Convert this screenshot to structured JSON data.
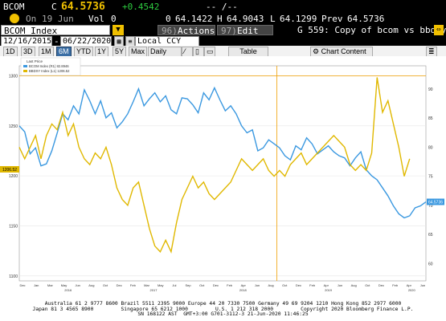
{
  "quote": {
    "ticker": "BCOM",
    "flag": "C",
    "last": "64.5736",
    "change": "+0.4542",
    "date_prefix": "On",
    "date": "19 Jun",
    "vol_label": "Vol",
    "vol": "0",
    "dashes": "-- /--",
    "open": "0",
    "open_value": "64.1422",
    "high_label": "H",
    "high": "64.9043",
    "low_label": "L",
    "low": "64.1299",
    "prev_label": "Prev",
    "prev": "64.5736"
  },
  "toolbar": {
    "security": "BCOM Index",
    "actions_num": "96)",
    "actions_label": "Actions",
    "edit_num": "97)",
    "edit_label": "Edit",
    "title": "G 559: Copy of bcom vs bbdxy",
    "start_date": "12/16/2015",
    "end_date": "06/22/2020",
    "currency": "Local CCY"
  },
  "periods": [
    "1D",
    "3D",
    "1M",
    "6M",
    "YTD",
    "1Y",
    "5Y",
    "Max"
  ],
  "selected_period": "6M",
  "frequency": "Daily",
  "table_label": "Table",
  "chart_content_label": "Chart Content",
  "colors": {
    "bcom": "#3a98e0",
    "bbdxy": "#e0b800",
    "accent": "#f0c000"
  },
  "chart_data": {
    "type": "line",
    "legend_title": "Last Price",
    "series": [
      {
        "name": "BCOM Index (R1) 82.8946",
        "axis": "left",
        "last_label": "64.5736"
      },
      {
        "name": "BBDXY Index (L1) 1206.52",
        "axis": "right",
        "last_label": "1206.52"
      }
    ],
    "left_axis": {
      "ticks": [
        "1300",
        "1250",
        "1200",
        "1150",
        "1100"
      ],
      "range": [
        1095,
        1310
      ],
      "flag": "1206.52"
    },
    "right_axis": {
      "ticks": [
        "90",
        "85",
        "80",
        "75",
        "70",
        "65",
        "60"
      ],
      "range": [
        57,
        94
      ],
      "flag": "64.5736"
    },
    "x_months": [
      "Dec",
      "Jan",
      "Mar",
      "May",
      "Jun",
      "Aug",
      "Oct",
      "Dec",
      "Feb",
      "Mar",
      "May",
      "Jul",
      "Sep",
      "Oct",
      "Dec",
      "Feb",
      "Apr",
      "Jun",
      "Aug",
      "Oct",
      "Dec",
      "Feb",
      "Apr",
      "Jun",
      "Aug",
      "Oct",
      "Dec",
      "Feb",
      "Apr",
      "Jun"
    ],
    "x_years": [
      "2016",
      "2017",
      "2018",
      "2019",
      "2020"
    ],
    "bcom": [
      [
        0,
        1250
      ],
      [
        2,
        1244
      ],
      [
        4,
        1222
      ],
      [
        6,
        1228
      ],
      [
        8,
        1210
      ],
      [
        10,
        1212
      ],
      [
        12,
        1225
      ],
      [
        14,
        1243
      ],
      [
        16,
        1262
      ],
      [
        18,
        1256
      ],
      [
        20,
        1270
      ],
      [
        22,
        1262
      ],
      [
        24,
        1286
      ],
      [
        26,
        1275
      ],
      [
        28,
        1262
      ],
      [
        30,
        1275
      ],
      [
        32,
        1258
      ],
      [
        34,
        1263
      ],
      [
        36,
        1248
      ],
      [
        38,
        1254
      ],
      [
        40,
        1262
      ],
      [
        42,
        1274
      ],
      [
        44,
        1287
      ],
      [
        46,
        1270
      ],
      [
        48,
        1277
      ],
      [
        50,
        1283
      ],
      [
        52,
        1274
      ],
      [
        54,
        1280
      ],
      [
        56,
        1266
      ],
      [
        58,
        1262
      ],
      [
        60,
        1278
      ],
      [
        62,
        1277
      ],
      [
        64,
        1271
      ],
      [
        66,
        1263
      ],
      [
        68,
        1283
      ],
      [
        70,
        1276
      ],
      [
        72,
        1288
      ],
      [
        74,
        1276
      ],
      [
        76,
        1265
      ],
      [
        78,
        1270
      ],
      [
        80,
        1262
      ],
      [
        82,
        1250
      ],
      [
        84,
        1243
      ],
      [
        86,
        1246
      ],
      [
        88,
        1225
      ],
      [
        90,
        1228
      ],
      [
        92,
        1236
      ],
      [
        94,
        1232
      ],
      [
        96,
        1228
      ],
      [
        98,
        1220
      ],
      [
        100,
        1216
      ],
      [
        102,
        1230
      ],
      [
        104,
        1226
      ],
      [
        106,
        1238
      ],
      [
        108,
        1232
      ],
      [
        110,
        1222
      ],
      [
        112,
        1226
      ],
      [
        114,
        1230
      ],
      [
        116,
        1224
      ],
      [
        118,
        1220
      ],
      [
        120,
        1218
      ],
      [
        122,
        1210
      ],
      [
        124,
        1218
      ],
      [
        126,
        1224
      ],
      [
        128,
        1206
      ],
      [
        130,
        1200
      ],
      [
        132,
        1196
      ],
      [
        134,
        1188
      ],
      [
        136,
        1180
      ],
      [
        138,
        1170
      ],
      [
        140,
        1162
      ],
      [
        142,
        1158
      ],
      [
        144,
        1160
      ],
      [
        146,
        1168
      ],
      [
        148,
        1170
      ],
      [
        150,
        1174
      ]
    ],
    "bbdxy": [
      [
        0,
        80
      ],
      [
        2,
        78
      ],
      [
        4,
        80
      ],
      [
        6,
        82
      ],
      [
        8,
        78
      ],
      [
        10,
        82
      ],
      [
        12,
        84
      ],
      [
        14,
        83
      ],
      [
        16,
        86
      ],
      [
        18,
        82
      ],
      [
        20,
        84
      ],
      [
        22,
        80
      ],
      [
        24,
        78
      ],
      [
        26,
        77
      ],
      [
        28,
        79
      ],
      [
        30,
        78
      ],
      [
        32,
        80
      ],
      [
        34,
        77
      ],
      [
        36,
        73
      ],
      [
        38,
        71
      ],
      [
        40,
        70
      ],
      [
        42,
        73
      ],
      [
        44,
        74
      ],
      [
        46,
        70
      ],
      [
        48,
        66
      ],
      [
        50,
        63
      ],
      [
        52,
        62
      ],
      [
        54,
        64
      ],
      [
        56,
        62
      ],
      [
        58,
        67
      ],
      [
        60,
        71
      ],
      [
        62,
        73
      ],
      [
        64,
        75
      ],
      [
        66,
        73
      ],
      [
        68,
        74
      ],
      [
        70,
        72
      ],
      [
        72,
        71
      ],
      [
        74,
        72
      ],
      [
        76,
        73
      ],
      [
        78,
        74
      ],
      [
        80,
        76
      ],
      [
        82,
        78
      ],
      [
        84,
        77
      ],
      [
        86,
        76
      ],
      [
        88,
        77
      ],
      [
        90,
        78
      ],
      [
        92,
        76
      ],
      [
        94,
        75
      ],
      [
        96,
        76
      ],
      [
        98,
        75
      ],
      [
        100,
        77
      ],
      [
        102,
        78
      ],
      [
        104,
        79
      ],
      [
        106,
        77
      ],
      [
        108,
        78
      ],
      [
        110,
        79
      ],
      [
        112,
        80
      ],
      [
        114,
        81
      ],
      [
        116,
        82
      ],
      [
        118,
        81
      ],
      [
        120,
        80
      ],
      [
        122,
        77
      ],
      [
        124,
        76
      ],
      [
        126,
        77
      ],
      [
        128,
        76
      ],
      [
        130,
        79
      ],
      [
        132,
        92
      ],
      [
        134,
        86
      ],
      [
        136,
        88
      ],
      [
        138,
        84
      ],
      [
        140,
        80
      ],
      [
        142,
        75
      ],
      [
        144,
        78
      ]
    ]
  },
  "footer": {
    "line1": "Australia 61 2 9777 8600 Brazil 5511 2395 9000 Europe 44 20 7330 7500 Germany 49 69 9204 1210 Hong Kong 852 2977 6000",
    "line2": "Japan 81 3 4565 8900         Singapore 65 6212 1000         U.S. 1 212 318 2000         Copyright 2020 Bloomberg Finance L.P.",
    "line3": "SN 168122 AST  GMT+3:00 G701-3112-3 21-Jun-2020 11:46:25"
  }
}
